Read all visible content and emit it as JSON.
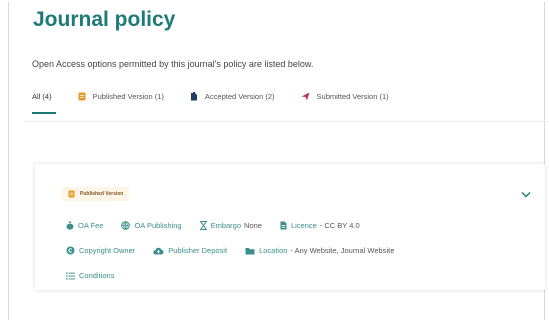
{
  "page": {
    "title": "Journal policy",
    "subtitle": "Open Access options permitted by this journal's policy are listed below."
  },
  "tabs": [
    {
      "label": "All (4)",
      "icon": "none",
      "active": true
    },
    {
      "label": "Published Version (1)",
      "icon": "document-icon",
      "color": "#e79a27"
    },
    {
      "label": "Accepted Version (2)",
      "icon": "bookmark-doc-icon",
      "color": "#1f3f66"
    },
    {
      "label": "Submitted Version (1)",
      "icon": "send-icon",
      "color": "#c2334b"
    }
  ],
  "card": {
    "badge": "Published Version",
    "row1": {
      "oa_fee": "OA Fee",
      "oa_publishing": "OA Publishing",
      "embargo_label": "Embargo",
      "embargo_value": "None",
      "licence_label": "Licence",
      "licence_value": "- CC BY 4.0"
    },
    "row2": {
      "copyright_owner": "Copyright Owner",
      "publisher_deposit": "Publisher Deposit",
      "location_label": "Location",
      "location_value": "- Any Website, Journal Website"
    },
    "row3": {
      "conditions": "Conditions"
    }
  },
  "colors": {
    "accent": "#1d7b77",
    "link": "#3a8f8c",
    "badge_bg": "#fff5e6"
  }
}
